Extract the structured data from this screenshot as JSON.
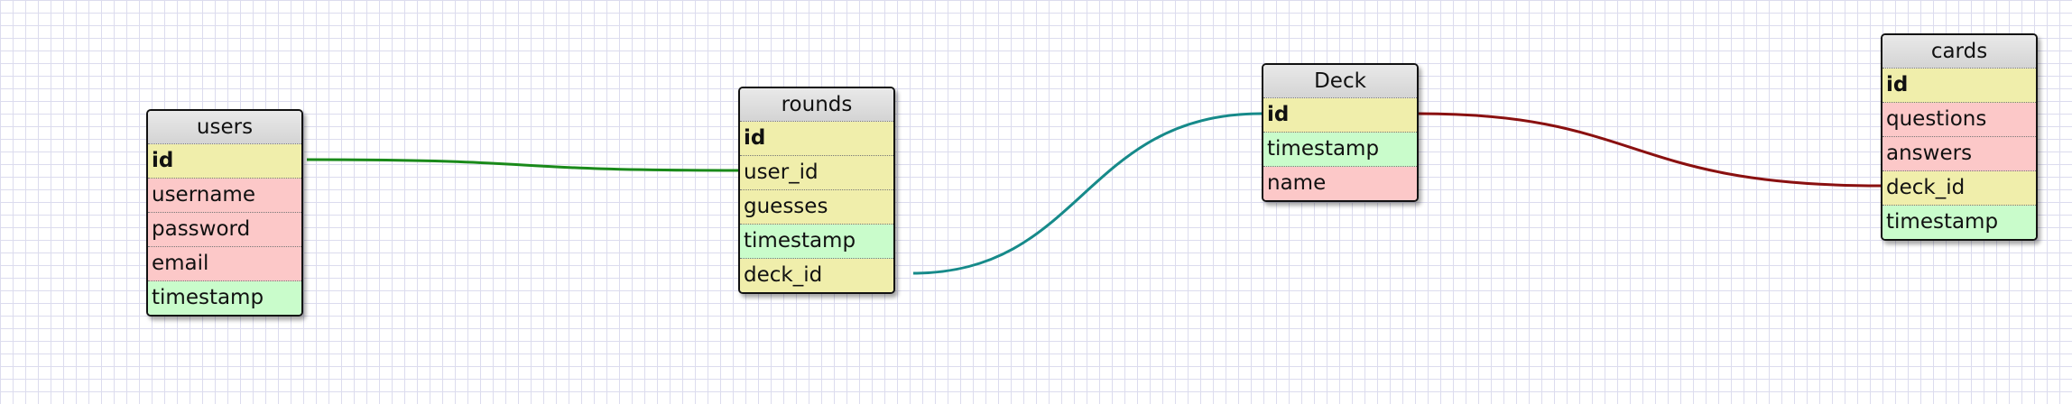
{
  "tables": {
    "users": {
      "name": "users",
      "fields": [
        {
          "label": "id",
          "color": "yellow",
          "primary": true
        },
        {
          "label": "username",
          "color": "red",
          "primary": false
        },
        {
          "label": "password",
          "color": "red",
          "primary": false
        },
        {
          "label": "email",
          "color": "red",
          "primary": false
        },
        {
          "label": "timestamp",
          "color": "green",
          "primary": false
        }
      ]
    },
    "rounds": {
      "name": "rounds",
      "fields": [
        {
          "label": "id",
          "color": "yellow",
          "primary": true
        },
        {
          "label": "user_id",
          "color": "yellow",
          "primary": false
        },
        {
          "label": "guesses",
          "color": "yellow",
          "primary": false
        },
        {
          "label": "timestamp",
          "color": "green",
          "primary": false
        },
        {
          "label": "deck_id",
          "color": "yellow",
          "primary": false
        }
      ]
    },
    "deck": {
      "name": "Deck",
      "fields": [
        {
          "label": "id",
          "color": "yellow",
          "primary": true
        },
        {
          "label": "timestamp",
          "color": "green",
          "primary": false
        },
        {
          "label": "name",
          "color": "red",
          "primary": false
        }
      ]
    },
    "cards": {
      "name": "cards",
      "fields": [
        {
          "label": "id",
          "color": "yellow",
          "primary": true
        },
        {
          "label": "questions",
          "color": "red",
          "primary": false
        },
        {
          "label": "answers",
          "color": "red",
          "primary": false
        },
        {
          "label": "deck_id",
          "color": "yellow",
          "primary": false
        },
        {
          "label": "timestamp",
          "color": "green",
          "primary": false
        }
      ]
    }
  },
  "relations": [
    {
      "from": "users.id",
      "to": "rounds.user_id",
      "color": "#1a8a1a"
    },
    {
      "from": "rounds.deck_id",
      "to": "deck.id",
      "color": "#168a8a"
    },
    {
      "from": "deck.id",
      "to": "cards.deck_id",
      "color": "#8a1010"
    }
  ]
}
